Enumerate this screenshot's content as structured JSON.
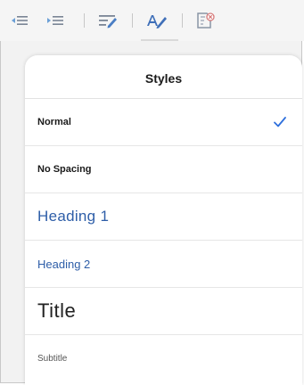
{
  "toolbar": {
    "icons": [
      "decrease-indent-icon",
      "increase-indent-icon",
      "paragraph-style-icon",
      "text-styles-icon",
      "clear-formatting-icon"
    ],
    "active_icon": "text-styles-icon"
  },
  "styles_panel": {
    "title": "Styles",
    "items": [
      {
        "label": "Normal",
        "selected": true
      },
      {
        "label": "No Spacing",
        "selected": false
      },
      {
        "label": "Heading 1",
        "selected": false
      },
      {
        "label": "Heading 2",
        "selected": false
      },
      {
        "label": "Title",
        "selected": false
      },
      {
        "label": "Subtitle",
        "selected": false
      }
    ],
    "check_icon": "checkmark-icon"
  },
  "colors": {
    "accent": "#2e6fdc",
    "heading": "#2e5ea8",
    "toolbar_icon": "#6b7a90"
  }
}
